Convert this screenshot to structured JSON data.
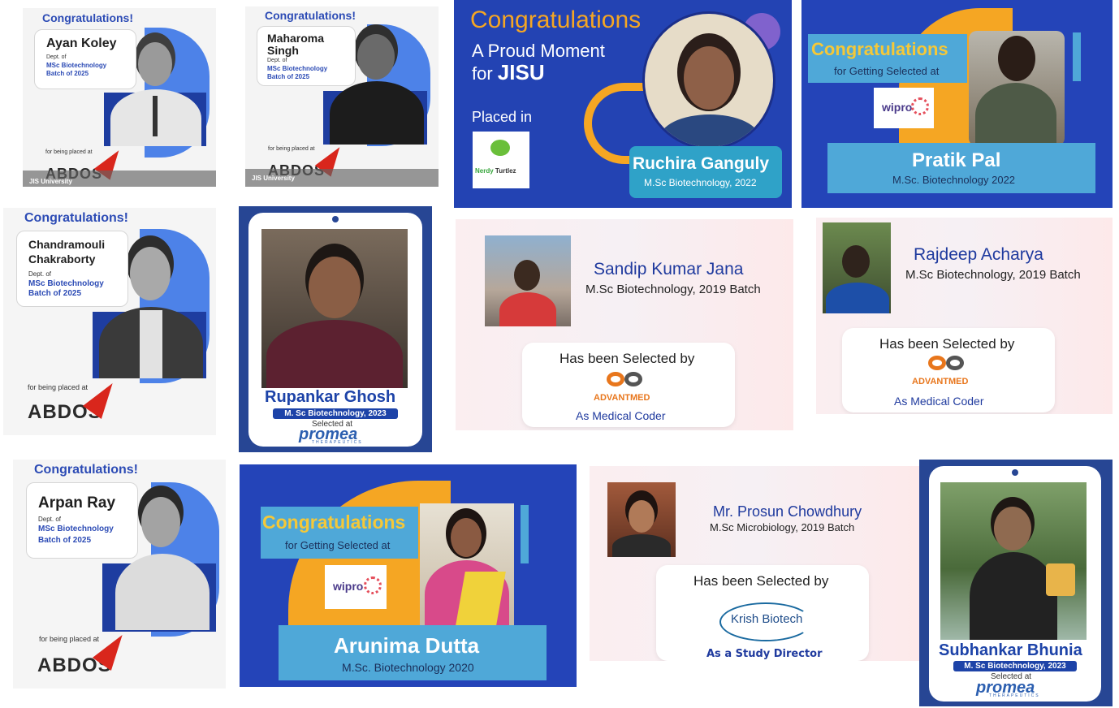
{
  "cards": {
    "ayan": {
      "congrats": "Congratulations!",
      "name": "Ayan Koley",
      "dept": "Dept. of",
      "program": "MSc Biotechnology",
      "batch": "Batch of 2025",
      "placed": "for being placed at",
      "company": "ABDOS",
      "footer": "JIS University"
    },
    "maharoma": {
      "congrats": "Congratulations!",
      "name1": "Maharoma",
      "name2": "Singh",
      "dept": "Dept. of",
      "program": "MSc Biotechnology",
      "batch": "Batch of 2025",
      "placed": "for being placed at",
      "company": "ABDOS",
      "footer": "JIS University"
    },
    "ruchira": {
      "title": "Congratulations",
      "line1": "A Proud Moment",
      "line2": "for ",
      "line2b": "JISU",
      "placed": "Placed in",
      "logo_text1": "Nerdy",
      "logo_text2": "Turtlez",
      "name": "Ruchira Ganguly",
      "course": "M.Sc Biotechnology, 2022"
    },
    "pratik": {
      "title": "Congratulations",
      "sub": "for Getting Selected at",
      "company": "wipro",
      "name": "Pratik Pal",
      "course": "M.Sc. Biotechnology 2022"
    },
    "chandramouli": {
      "congrats": "Congratulations!",
      "name1": "Chandramouli",
      "name2": "Chakraborty",
      "dept": "Dept. of",
      "program": "MSc Biotechnology",
      "batch": "Batch of 2025",
      "placed": "for being placed at",
      "company": "ABDOS"
    },
    "rupankar": {
      "name": "Rupankar Ghosh",
      "course": "M. Sc Biotechnology, 2023",
      "selected": "Selected at",
      "company": "promea",
      "company_sub": "THERAPEUTICS"
    },
    "sandip": {
      "name": "Sandip Kumar Jana",
      "course": "M.Sc Biotechnology, 2019 Batch",
      "selected": "Has been Selected by",
      "company": "ADVANTMED",
      "role": "As Medical Coder"
    },
    "rajdeep": {
      "name": "Rajdeep Acharya",
      "course": "M.Sc Biotechnology, 2019 Batch",
      "selected": "Has been Selected by",
      "company": "ADVANTMED",
      "role": "As Medical Coder"
    },
    "arpan": {
      "congrats": "Congratulations!",
      "name": "Arpan Ray",
      "dept": "Dept. of",
      "program": "MSc Biotechnology",
      "batch": "Batch of 2025",
      "placed": "for being placed at",
      "company": "ABDOS"
    },
    "arunima": {
      "title": "Congratulations",
      "sub": "for Getting Selected at",
      "company": "wipro",
      "name": "Arunima Dutta",
      "course": "M.Sc. Biotechnology 2020"
    },
    "prosun": {
      "name": "Mr. Prosun Chowdhury",
      "course": "M.Sc Microbiology, 2019 Batch",
      "selected": "Has been Selected by",
      "company": "Krish Biotech",
      "role": "As a Study Director"
    },
    "subhankar": {
      "name": "Subhankar Bhunia",
      "course": "M. Sc Biotechnology, 2023",
      "selected": "Selected at",
      "company": "promea",
      "company_sub": "THERAPEUTICS"
    }
  },
  "colors": {
    "accent_blue": "#2c4bb5",
    "orange": "#f5a623",
    "teal": "#4fa8d8",
    "advantmed_orange": "#e8761c",
    "pink_bg": "#fbeef0"
  }
}
